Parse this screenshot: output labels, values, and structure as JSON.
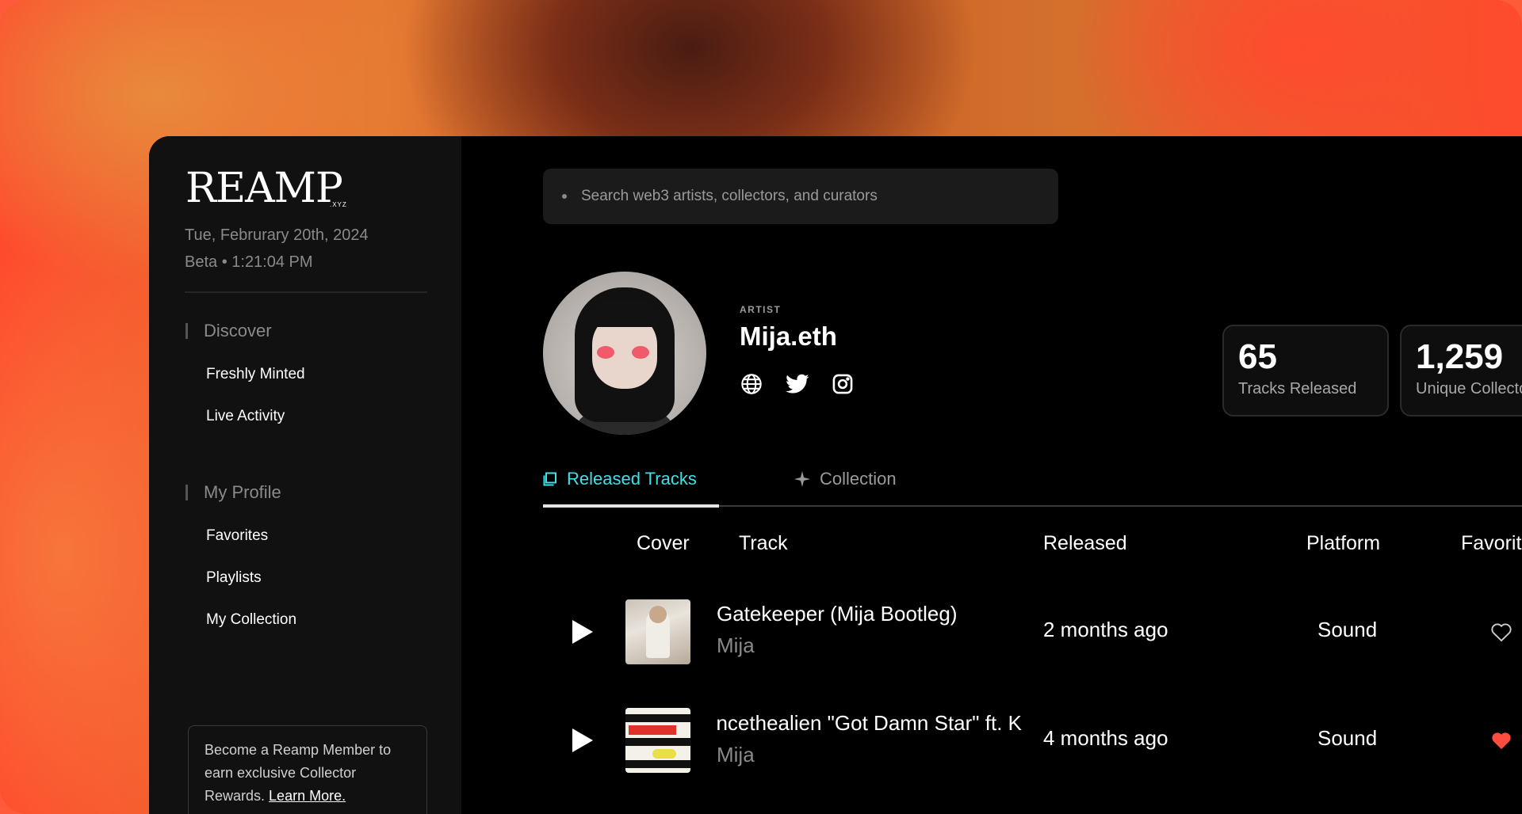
{
  "brand": {
    "logo": "REAMP",
    "logo_sub": ".XYZ"
  },
  "sidebar": {
    "date": "Tue, Februrary 20th, 2024",
    "status": "Beta • 1:21:04 PM",
    "sections": [
      {
        "label": "Discover",
        "items": [
          "Freshly Minted",
          "Live Activity"
        ]
      },
      {
        "label": "My Profile",
        "items": [
          "Favorites",
          "Playlists",
          "My Collection"
        ]
      }
    ],
    "promo": {
      "text": "Become a Reamp Member to earn exclusive Collector Rewards.",
      "link": "Learn More."
    }
  },
  "search": {
    "placeholder": "Search web3 artists, collectors, and curators"
  },
  "artist": {
    "tag": "ARTIST",
    "name": "Mija.eth",
    "socials": [
      "globe-icon",
      "twitter-icon",
      "instagram-icon"
    ]
  },
  "stats": [
    {
      "value": "65",
      "label": "Tracks Released"
    },
    {
      "value": "1,259",
      "label": "Unique Collectors"
    }
  ],
  "tabs": [
    {
      "label": "Released Tracks",
      "active": true
    },
    {
      "label": "Collection",
      "active": false
    }
  ],
  "table": {
    "headers": [
      "Cover",
      "Track",
      "Released",
      "Platform",
      "Favorite"
    ],
    "rows": [
      {
        "title": "Gatekeeper (Mija Bootleg)",
        "artist": "Mija",
        "released": "2 months ago",
        "platform": "Sound",
        "favorited": false
      },
      {
        "title": "Vincethealien \"Got Damn Star\" ft. K",
        "artist": "Mija",
        "released": "4 months ago",
        "platform": "Sound",
        "favorited": true
      }
    ]
  },
  "colors": {
    "accent": "#3fe0e6",
    "heart": "#ff4d3d",
    "sidebar": "#111111"
  }
}
